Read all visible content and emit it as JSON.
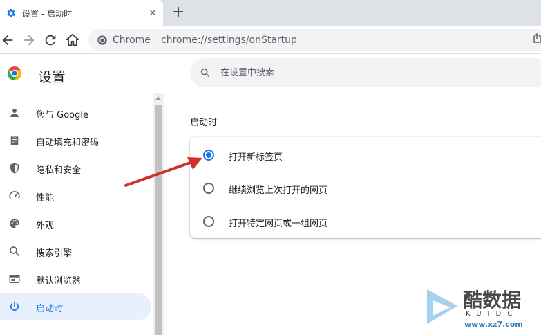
{
  "tab": {
    "title": "设置 - 启动时",
    "favicon": "gear-icon",
    "close": "×"
  },
  "new_tab": "+",
  "omnibox": {
    "site": "Chrome",
    "url": "chrome://settings/onStartup"
  },
  "settings": {
    "title": "设置",
    "search_placeholder": "在设置中搜索"
  },
  "sidebar": {
    "items": [
      {
        "label": "您与 Google",
        "icon": "person-icon"
      },
      {
        "label": "自动填充和密码",
        "icon": "clipboard-icon"
      },
      {
        "label": "隐私和安全",
        "icon": "shield-icon"
      },
      {
        "label": "性能",
        "icon": "speedometer-icon"
      },
      {
        "label": "外观",
        "icon": "palette-icon"
      },
      {
        "label": "搜索引擎",
        "icon": "search-icon"
      },
      {
        "label": "默认浏览器",
        "icon": "browser-icon"
      },
      {
        "label": "启动时",
        "icon": "power-icon",
        "active": true
      }
    ]
  },
  "main": {
    "section_title": "启动时",
    "options": [
      {
        "label": "打开新标签页",
        "checked": true
      },
      {
        "label": "继续浏览上次打开的网页",
        "checked": false
      },
      {
        "label": "打开特定网页或一组网页",
        "checked": false
      }
    ]
  },
  "watermark": {
    "brand": "酷数据",
    "sub": "KUIDC",
    "url": "www.xz7.com"
  },
  "colors": {
    "accent": "#1a73e8",
    "active_bg": "#e8f0fe",
    "arrow": "#d0312d"
  }
}
